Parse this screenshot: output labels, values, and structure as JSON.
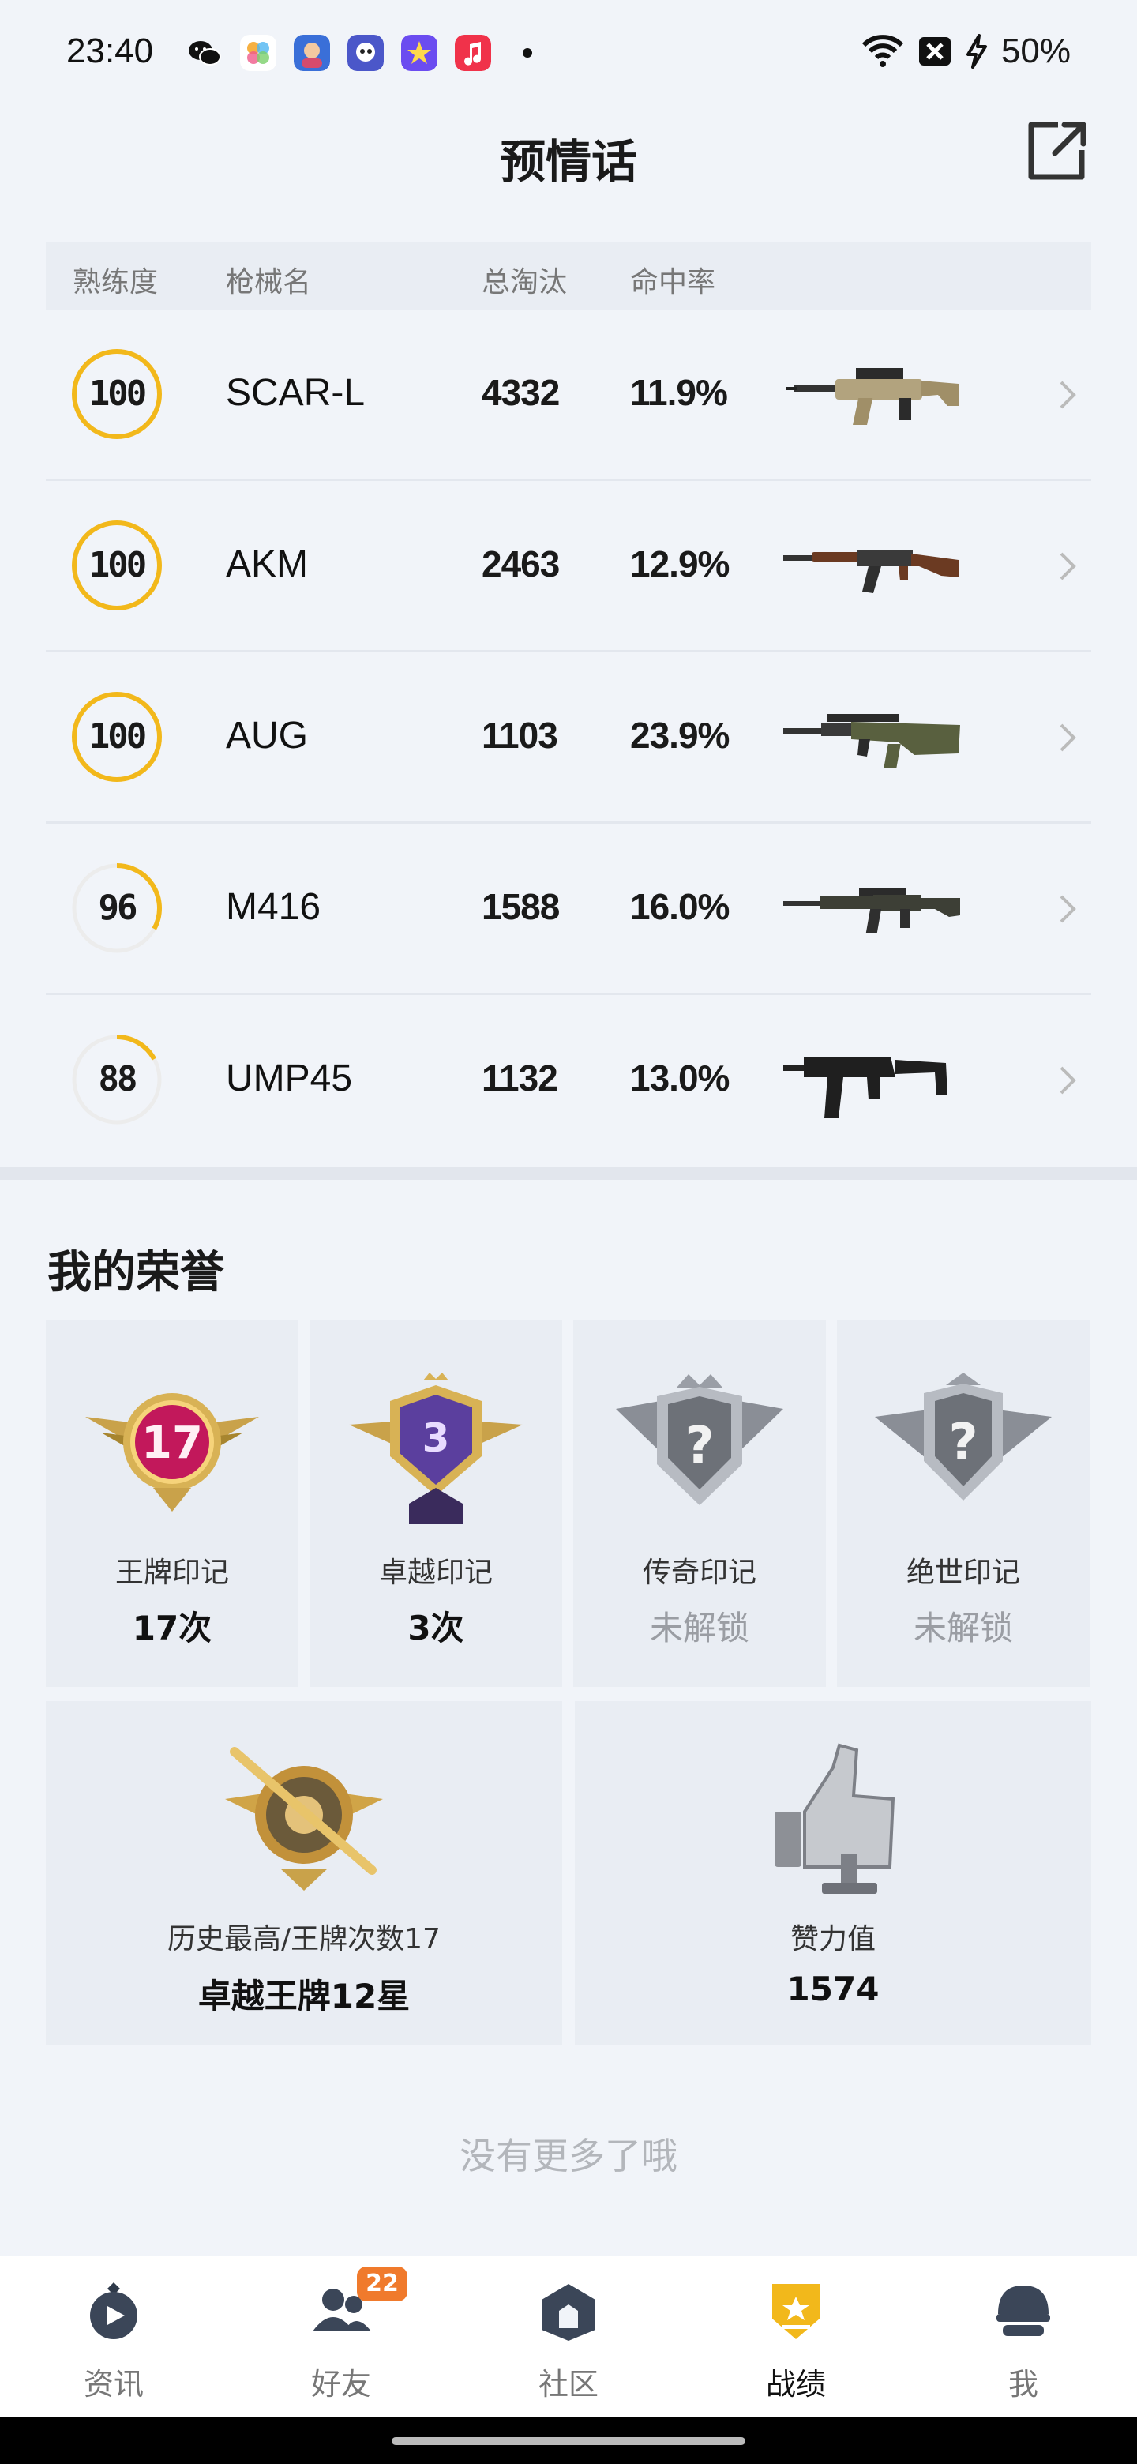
{
  "status_bar": {
    "time": "23:40",
    "battery": "50%",
    "icons": [
      "wechat-icon",
      "photos-icon",
      "game-app-icon",
      "game-app-icon-2",
      "star-app-icon",
      "music-app-icon",
      "wifi-icon",
      "sim-blocked-icon",
      "charging-icon"
    ]
  },
  "header": {
    "title": "预情话",
    "share_icon": "share-icon"
  },
  "weapon_table": {
    "columns": [
      "熟练度",
      "枪械名",
      "总淘汰",
      "命中率"
    ],
    "rows": [
      {
        "mastery": "100",
        "mastery_pct": 100,
        "name": "SCAR-L",
        "kills": "4332",
        "hit_rate": "11.9%"
      },
      {
        "mastery": "100",
        "mastery_pct": 100,
        "name": "AKM",
        "kills": "2463",
        "hit_rate": "12.9%"
      },
      {
        "mastery": "100",
        "mastery_pct": 100,
        "name": "AUG",
        "kills": "1103",
        "hit_rate": "23.9%"
      },
      {
        "mastery": "96",
        "mastery_pct": 33,
        "name": "M416",
        "kills": "1588",
        "hit_rate": "16.0%"
      },
      {
        "mastery": "88",
        "mastery_pct": 17,
        "name": "UMP45",
        "kills": "1132",
        "hit_rate": "13.0%"
      }
    ]
  },
  "honor": {
    "title": "我的荣誉",
    "marks": [
      {
        "label": "王牌印记",
        "value": "17次",
        "badge": "17",
        "locked": false
      },
      {
        "label": "卓越印记",
        "value": "3次",
        "badge": "3",
        "locked": false
      },
      {
        "label": "传奇印记",
        "value": "未解锁",
        "badge": "?",
        "locked": true
      },
      {
        "label": "绝世印记",
        "value": "未解锁",
        "badge": "?",
        "locked": true
      }
    ],
    "history": {
      "label": "历史最高/王牌次数17",
      "value": "卓越王牌12星"
    },
    "likes": {
      "label": "赞力值",
      "value": "1574"
    }
  },
  "footer_text": "没有更多了哦",
  "bottom_nav": {
    "items": [
      {
        "label": "资讯",
        "icon": "news-icon"
      },
      {
        "label": "好友",
        "icon": "friends-icon",
        "badge": "22"
      },
      {
        "label": "社区",
        "icon": "community-icon"
      },
      {
        "label": "战绩",
        "icon": "stats-icon",
        "active": true
      },
      {
        "label": "我",
        "icon": "profile-icon"
      }
    ]
  },
  "colors": {
    "ring": "#f2b81b",
    "ring_track": "#ececec",
    "badge": "#f07a2c",
    "active_nav": "#f2b81b"
  }
}
